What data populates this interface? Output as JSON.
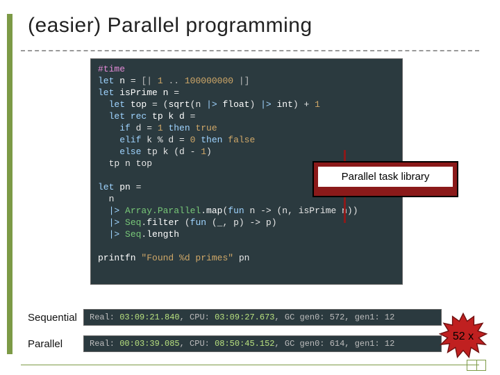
{
  "title": "(easier) Parallel programming",
  "annotation": "Parallel task library",
  "speedup": "52 x",
  "labels": {
    "sequential": "Sequential",
    "parallel": "Parallel"
  },
  "code": {
    "l1": "#time",
    "l2_let": "let ",
    "l2_var": "n ",
    "l2_eq": "= ",
    "l2_open": "[| ",
    "l2_a": "1 ",
    "l2_dots": ".. ",
    "l2_b": "100000000 ",
    "l2_close": "|]",
    "l3_let": "let ",
    "l3_name": "isPrime n ",
    "l3_eq": "=",
    "l4_let": "  let ",
    "l4_name": "top ",
    "l4_eq": "= (",
    "l4_sqrt": "sqrt",
    "l4_paren1": "(n ",
    "l4_pipe1": "|> ",
    "l4_float": "float",
    "l4_paren2": ") ",
    "l4_pipe2": "|> ",
    "l4_int": "int",
    "l4_plus": ") + ",
    "l4_one": "1",
    "l5_let": "  let rec ",
    "l5_name": "tp k d ",
    "l5_eq": "=",
    "l6_if": "    if ",
    "l6_cond": "d = ",
    "l6_one": "1 ",
    "l6_then": "then ",
    "l6_true": "true",
    "l7_elif": "    elif ",
    "l7_cond": "k % d = ",
    "l7_zero": "0 ",
    "l7_then": "then ",
    "l7_false": "false",
    "l8_else": "    else ",
    "l8_call": "tp k (d - ",
    "l8_one": "1",
    "l8_close": ")",
    "l9": "  tp n top",
    "l11_let": "let ",
    "l11_name": "pn ",
    "l11_eq": "=",
    "l12": "  n",
    "l13_pipe": "  |> ",
    "l13_mod": "Array.Parallel",
    "l13_dot": ".",
    "l13_map": "map",
    "l13_open": "(",
    "l13_fun": "fun ",
    "l13_arg": "n -> (n, isPrime n))",
    "l14_pipe": "  |> ",
    "l14_mod": "Seq",
    "l14_dot": ".",
    "l14_filt": "filter ",
    "l14_open": "(",
    "l14_fun": "fun ",
    "l14_arg": "(_, p) -> p)",
    "l15_pipe": "  |> ",
    "l15_mod": "Seq",
    "l15_dot": ".",
    "l15_len": "length",
    "l17_call": "printfn ",
    "l17_str": "\"Found %d primes\" ",
    "l17_arg": "pn"
  },
  "timing": {
    "seq_pre": "Real: ",
    "seq_real": "03:09:21.840",
    "seq_mid": ", CPU: ",
    "seq_cpu": "03:09:27.673",
    "seq_gc": ", GC gen0: 572, gen1: 12",
    "par_pre": "Real: ",
    "par_real": "00:03:39.085",
    "par_mid": ", CPU: ",
    "par_cpu": "08:50:45.152",
    "par_gc": ", GC gen0: 614, gen1: 12"
  }
}
